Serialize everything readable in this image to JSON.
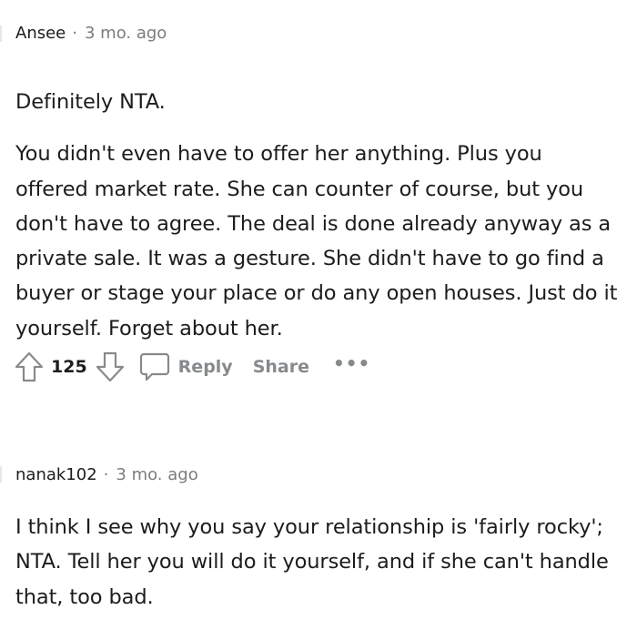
{
  "comments": [
    {
      "author": "Ansee",
      "separator": "·",
      "time": "3 mo. ago",
      "paragraphs": [
        "Definitely NTA.",
        "You didn't even have to offer her anything. Plus you offered market rate. She can counter of course, but you don't have to agree. The deal is done already anyway as a private sale. It was a gesture. She didn't have to go find a buyer or stage your place or do any open houses. Just do it yourself. Forget about her."
      ],
      "score": "125",
      "reply_label": "Reply",
      "share_label": "Share",
      "more_label": "•••"
    },
    {
      "author": "nanak102",
      "separator": "·",
      "time": "3 mo. ago",
      "paragraphs": [
        "I think I see why you say your relationship is 'fairly rocky'; NTA. Tell her you will do it yourself, and if she can't handle that, too bad."
      ]
    }
  ],
  "colors": {
    "text": "#1c1c1c",
    "meta": "#7c7c7c",
    "action": "#878a8c",
    "thread_line": "#e5e7eb"
  },
  "icons": [
    "upvote-icon",
    "downvote-icon",
    "comment-bubble-icon"
  ]
}
